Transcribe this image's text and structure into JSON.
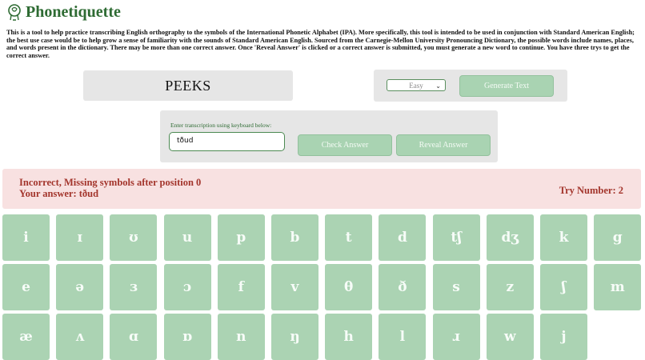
{
  "app": {
    "title": "Phonetiquette",
    "intro": "This is a tool to help practice transcribing English orthography to the symbols of the International Phonetic Alphabet (IPA). More specifically, this tool is intended to be used in conjunction with Standard American English; the best use case would be to help grow a sense of familiarity with the sounds of Standard American English. Sourced from the Carnegie-Mellon University Pronouncing Dictionary, the possible words include names, places, and words present in the dictionary. There may be more than one correct answer. Once 'Reveal Answer' is clicked or a correct answer is submitted, you must generate a new word to continue. You have three trys to get the correct answer."
  },
  "word": {
    "current": "PEEKS"
  },
  "controls": {
    "difficulty": "Easy",
    "generate_label": "Generate Text"
  },
  "entry": {
    "label": "Enter transcription using keyboard below:",
    "value": "tðud",
    "check_label": "Check Answer",
    "reveal_label": "Reveal Answer"
  },
  "result": {
    "message": "Incorrect, Missing symbols after position 0",
    "answer": "Your answer: tðud",
    "try": "Try Number: 2"
  },
  "keyboard": {
    "rows": [
      [
        "i",
        "ɪ",
        "ʊ",
        "u",
        "p",
        "b",
        "t",
        "d",
        "tʃ",
        "dʒ",
        "k",
        "g"
      ],
      [
        "e",
        "ə",
        "ɜ",
        "ɔ",
        "f",
        "v",
        "θ",
        "ð",
        "s",
        "z",
        "ʃ",
        "m"
      ],
      [
        "æ",
        "ʌ",
        "ɑ",
        "ɒ",
        "n",
        "ŋ",
        "h",
        "l",
        "ɹ",
        "w",
        "j"
      ]
    ]
  },
  "colors": {
    "brand_green": "#2e6b33",
    "button_green": "#a9d3b2",
    "panel_gray": "#e6e6e6",
    "error_bg": "#f8e1e1",
    "error_text": "#a3352c"
  }
}
